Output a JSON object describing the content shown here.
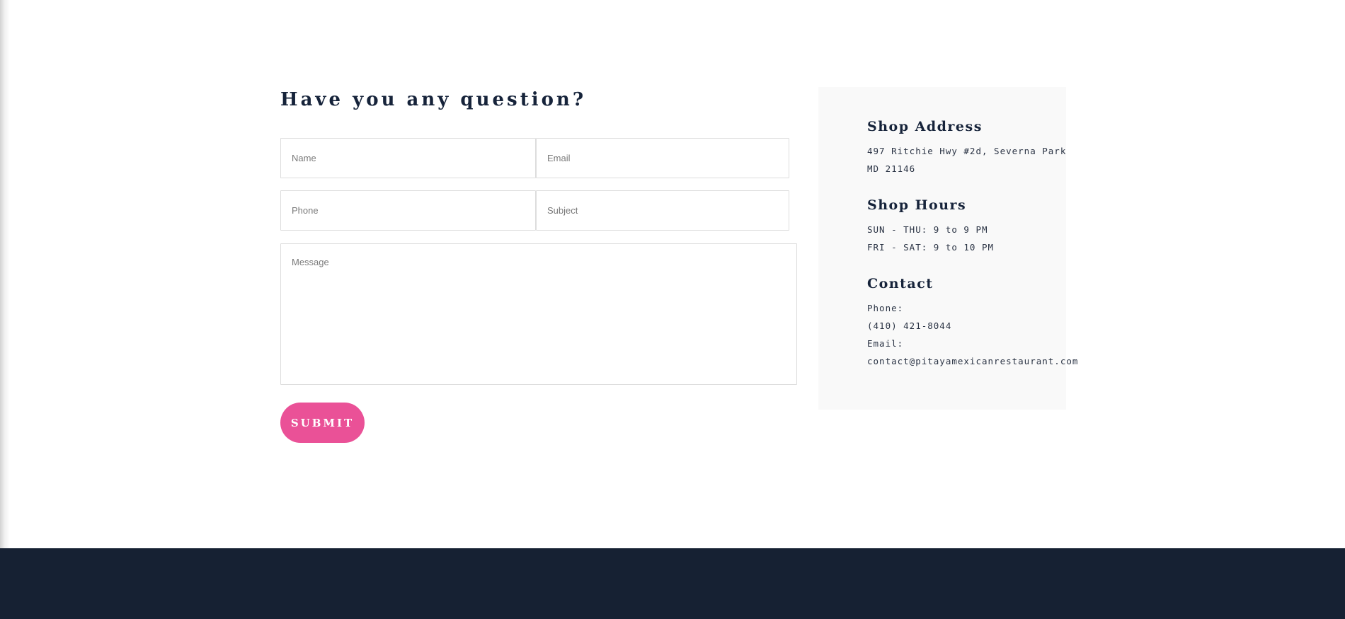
{
  "contact_form": {
    "title": "Have you any question?",
    "name_placeholder": "Name",
    "email_placeholder": "Email",
    "phone_placeholder": "Phone",
    "subject_placeholder": "Subject",
    "message_placeholder": "Message",
    "submit_label": "SUBMIT"
  },
  "info": {
    "address_heading": "Shop Address",
    "address_line1": "497 Ritchie Hwy #2d, Severna Park",
    "address_line2": "MD 21146",
    "hours_heading": "Shop Hours",
    "hours_line1": "SUN - THU: 9 to 9 PM",
    "hours_line2": "FRI - SAT: 9 to 10 PM",
    "contact_heading": "Contact",
    "phone_label": "Phone:",
    "phone_value": "(410) 421-8044",
    "email_label": "Email:",
    "email_value": "contact@pitayamexicanrestaurant.com"
  },
  "colors": {
    "accent": "#ea5197",
    "heading": "#16233a",
    "footer": "#162133",
    "card_bg": "#f9f9f9"
  }
}
